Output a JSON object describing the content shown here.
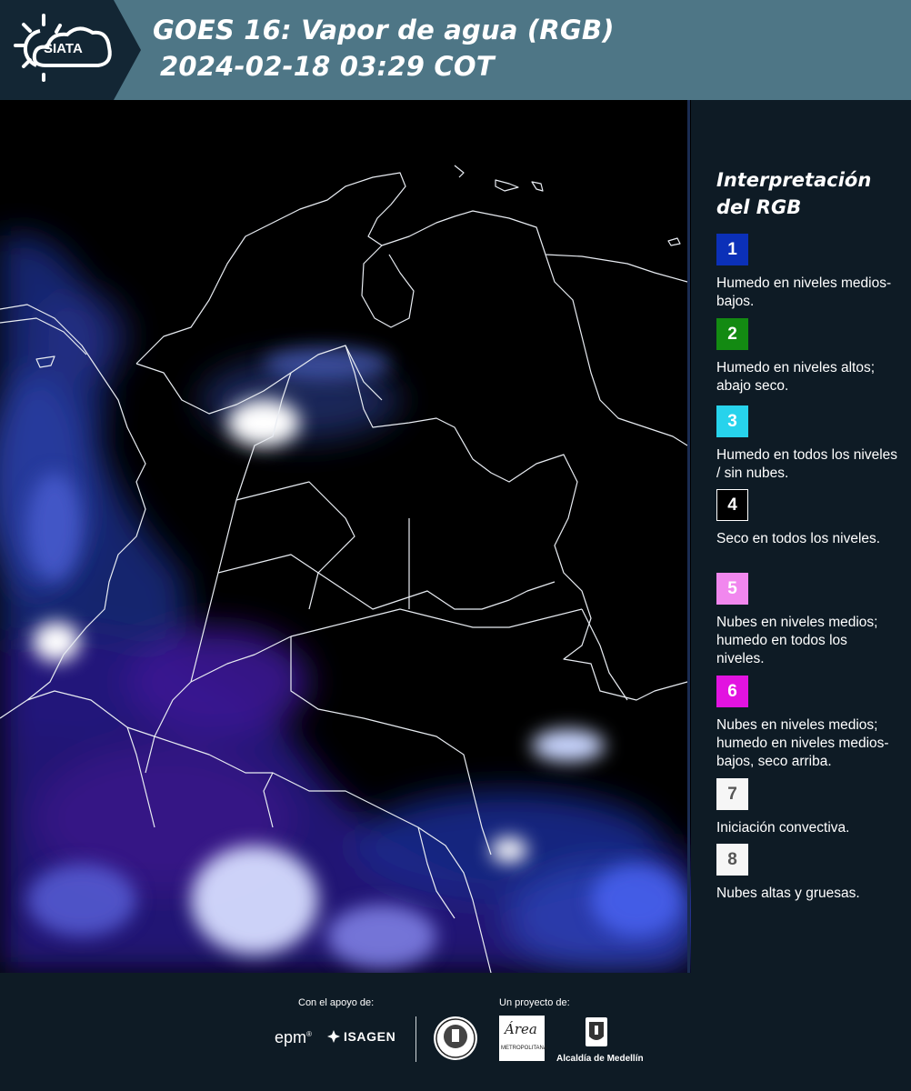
{
  "brand": {
    "logo_text": "SIATA"
  },
  "header": {
    "title_line1": "GOES 16: Vapor de agua (RGB)",
    "title_line2": "2024-02-18 03:29 COT"
  },
  "legend": {
    "title_line1": "Interpretación",
    "title_line2": "del RGB",
    "items": [
      {
        "number": "1",
        "color": "#0b30b8",
        "text_color": "#ffffff",
        "border": "none",
        "description": "Humedo en niveles medios-bajos."
      },
      {
        "number": "2",
        "color": "#138a12",
        "text_color": "#ffffff",
        "border": "none",
        "description": "Humedo en niveles altos; abajo seco."
      },
      {
        "number": "3",
        "color": "#27d3ec",
        "text_color": "#ffffff",
        "border": "none",
        "description": "Humedo en todos los niveles / sin nubes."
      },
      {
        "number": "4",
        "color": "#000000",
        "text_color": "#ffffff",
        "border": "1px solid #ffffff",
        "description": "Seco en todos los niveles."
      },
      {
        "number": "5",
        "color": "#f187ee",
        "text_color": "#ffffff",
        "border": "none",
        "description": "Nubes en niveles medios; humedo en todos los niveles."
      },
      {
        "number": "6",
        "color": "#e213e0",
        "text_color": "#ffffff",
        "border": "none",
        "description": "Nubes en niveles medios; humedo en niveles medios-bajos, seco arriba."
      },
      {
        "number": "7",
        "color": "#f6f6f6",
        "text_color": "#555555",
        "border": "none",
        "description": "Iniciación convectiva."
      },
      {
        "number": "8",
        "color": "#f6f6f6",
        "text_color": "#555555",
        "border": "none",
        "description": "Nubes altas y gruesas."
      }
    ]
  },
  "footer": {
    "support_label": "Con el apoyo de:",
    "project_label": "Un proyecto de:",
    "sponsor_epm": "epm",
    "sponsor_isagen": "ISAGEN",
    "area_logo_text": "Área",
    "area_caption": "METROPOLITANA",
    "alcaldia_caption": "Alcaldía de Medellín"
  }
}
